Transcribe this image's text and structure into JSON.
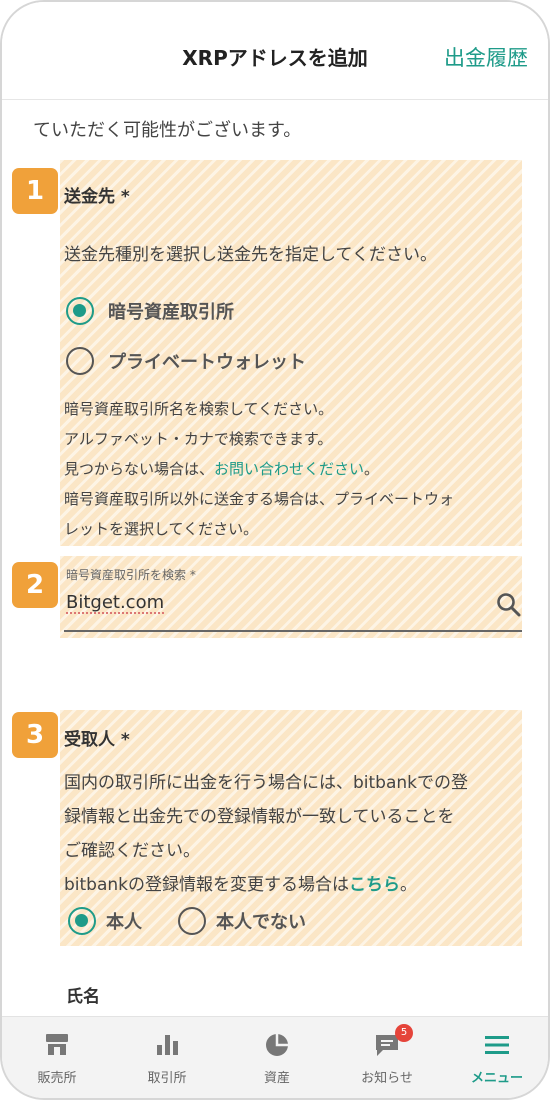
{
  "header": {
    "title": "XRPアドレスを追加",
    "history_link": "出金履歴"
  },
  "intro_text": "ていただく可能性がございます。",
  "section1": {
    "badge": "1",
    "label": "送金先 *",
    "instruction": "送金先種別を選択し送金先を指定してください。",
    "options": [
      {
        "label": "暗号資産取引所",
        "selected": true
      },
      {
        "label": "プライベートウォレット",
        "selected": false
      }
    ],
    "help_lines": {
      "l1": "暗号資産取引所名を検索してください。",
      "l2": "アルファベット・カナで検索できます。",
      "l3_prefix": "見つからない場合は、",
      "l3_link": "お問い合わせください",
      "l3_suffix": "。",
      "l4": "暗号資産取引所以外に送金する場合は、プライベートウォ",
      "l5": "レットを選択してください。"
    }
  },
  "section2": {
    "badge": "2",
    "field_label": "暗号資産取引所を検索 *",
    "field_value": "Bitget.com",
    "icon": "search-icon"
  },
  "section3": {
    "badge": "3",
    "label": "受取人 *",
    "lines": {
      "l1": "国内の取引所に出金を行う場合には、bitbankでの登",
      "l2": "録情報と出金先での登録情報が一致していることを",
      "l3": "ご確認ください。",
      "l4_prefix": "bitbankの登録情報を変更する場合は",
      "l4_link": "こちら",
      "l4_suffix": "。"
    },
    "options": [
      {
        "label": "本人",
        "selected": true
      },
      {
        "label": "本人でない",
        "selected": false
      }
    ]
  },
  "name_label": "氏名",
  "bottom_nav": {
    "items": [
      {
        "label": "販売所",
        "icon": "shop-icon",
        "active": false
      },
      {
        "label": "取引所",
        "icon": "bar-chart-icon",
        "active": false
      },
      {
        "label": "資産",
        "icon": "pie-chart-icon",
        "active": false
      },
      {
        "label": "お知らせ",
        "icon": "message-icon",
        "active": false,
        "badge": "5"
      },
      {
        "label": "メニュー",
        "icon": "hamburger-menu-icon",
        "active": true
      }
    ]
  },
  "colors": {
    "accent": "#1e9b89",
    "badge": "#f0a13a",
    "highlight": "#fbe6c6",
    "notification": "#e5443a"
  }
}
